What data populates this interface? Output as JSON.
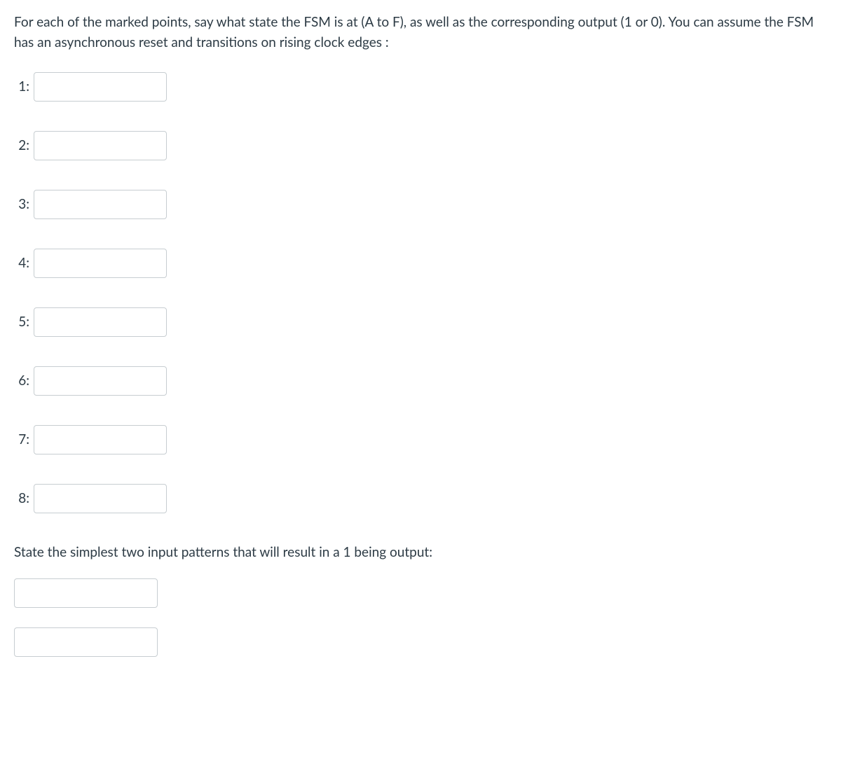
{
  "question": {
    "main_text": "For each of the marked points, say what state the FSM is at (A to F), as well as the corresponding output (1 or 0). You can assume the FSM has an asynchronous reset and transitions on rising clock edges :",
    "sub_text": "State the simplest two input patterns that will result in a 1 being output:"
  },
  "numbered_inputs": [
    {
      "label": "1:",
      "value": ""
    },
    {
      "label": "2:",
      "value": ""
    },
    {
      "label": "3:",
      "value": ""
    },
    {
      "label": "4:",
      "value": ""
    },
    {
      "label": "5:",
      "value": ""
    },
    {
      "label": "6:",
      "value": ""
    },
    {
      "label": "7:",
      "value": ""
    },
    {
      "label": "8:",
      "value": ""
    }
  ],
  "pattern_inputs": [
    {
      "value": ""
    },
    {
      "value": ""
    }
  ]
}
